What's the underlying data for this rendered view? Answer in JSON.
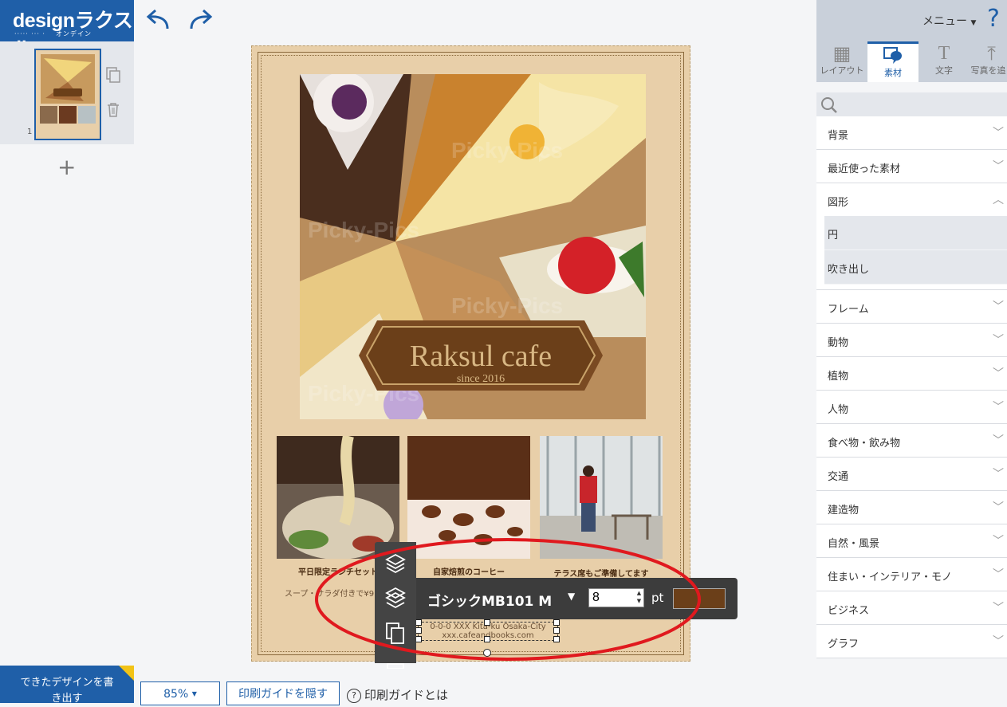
{
  "logo": {
    "main": "designラクスル",
    "sub": "オンデイン"
  },
  "thumbnail": {
    "page_number": "1"
  },
  "poster": {
    "title": "Raksul cafe",
    "subtitle": "since 2016",
    "captions": [
      "平日限定ランチセット",
      "自家焙煎のコーヒー",
      "テラス席もご準備してます"
    ],
    "sub_caption": "スープ・サラダ付きで¥9",
    "selected_text_line1": "0-0-0 XXX Kita-ku Osaka-City",
    "selected_text_line2": "xxx.cafeandbooks.com",
    "watermark": "Picky-Pics"
  },
  "text_toolbar": {
    "font_name": "ゴシックMB101 M",
    "font_size": "8",
    "unit": "pt",
    "text_color": "#6b3f19"
  },
  "right_panel": {
    "menu_label": "メニュー",
    "help_label": "?",
    "tabs": [
      {
        "label": "レイアウト",
        "icon": "layout-icon"
      },
      {
        "label": "素材",
        "icon": "material-icon"
      },
      {
        "label": "文字",
        "icon": "text-icon"
      },
      {
        "label": "写真を追",
        "icon": "upload-icon"
      }
    ],
    "categories": [
      "背景",
      "最近使った素材",
      "図形",
      "フレーム",
      "動物",
      "植物",
      "人物",
      "食べ物・飲み物",
      "交通",
      "建造物",
      "自然・風景",
      "住まい・インテリア・モノ",
      "ビジネス",
      "グラフ"
    ],
    "subcategories": [
      "円",
      "吹き出し"
    ]
  },
  "bottom": {
    "export_label": "できたデザインを書き出す",
    "zoom": "85%",
    "hide_guide": "印刷ガイドを隠す",
    "guide_help": "印刷ガイドとは"
  },
  "colors": {
    "brand_blue": "#1f5fa8",
    "poster_bg": "#e8cfa9",
    "badge_brown": "#6b3f19",
    "annotation_red": "#e0191e"
  }
}
